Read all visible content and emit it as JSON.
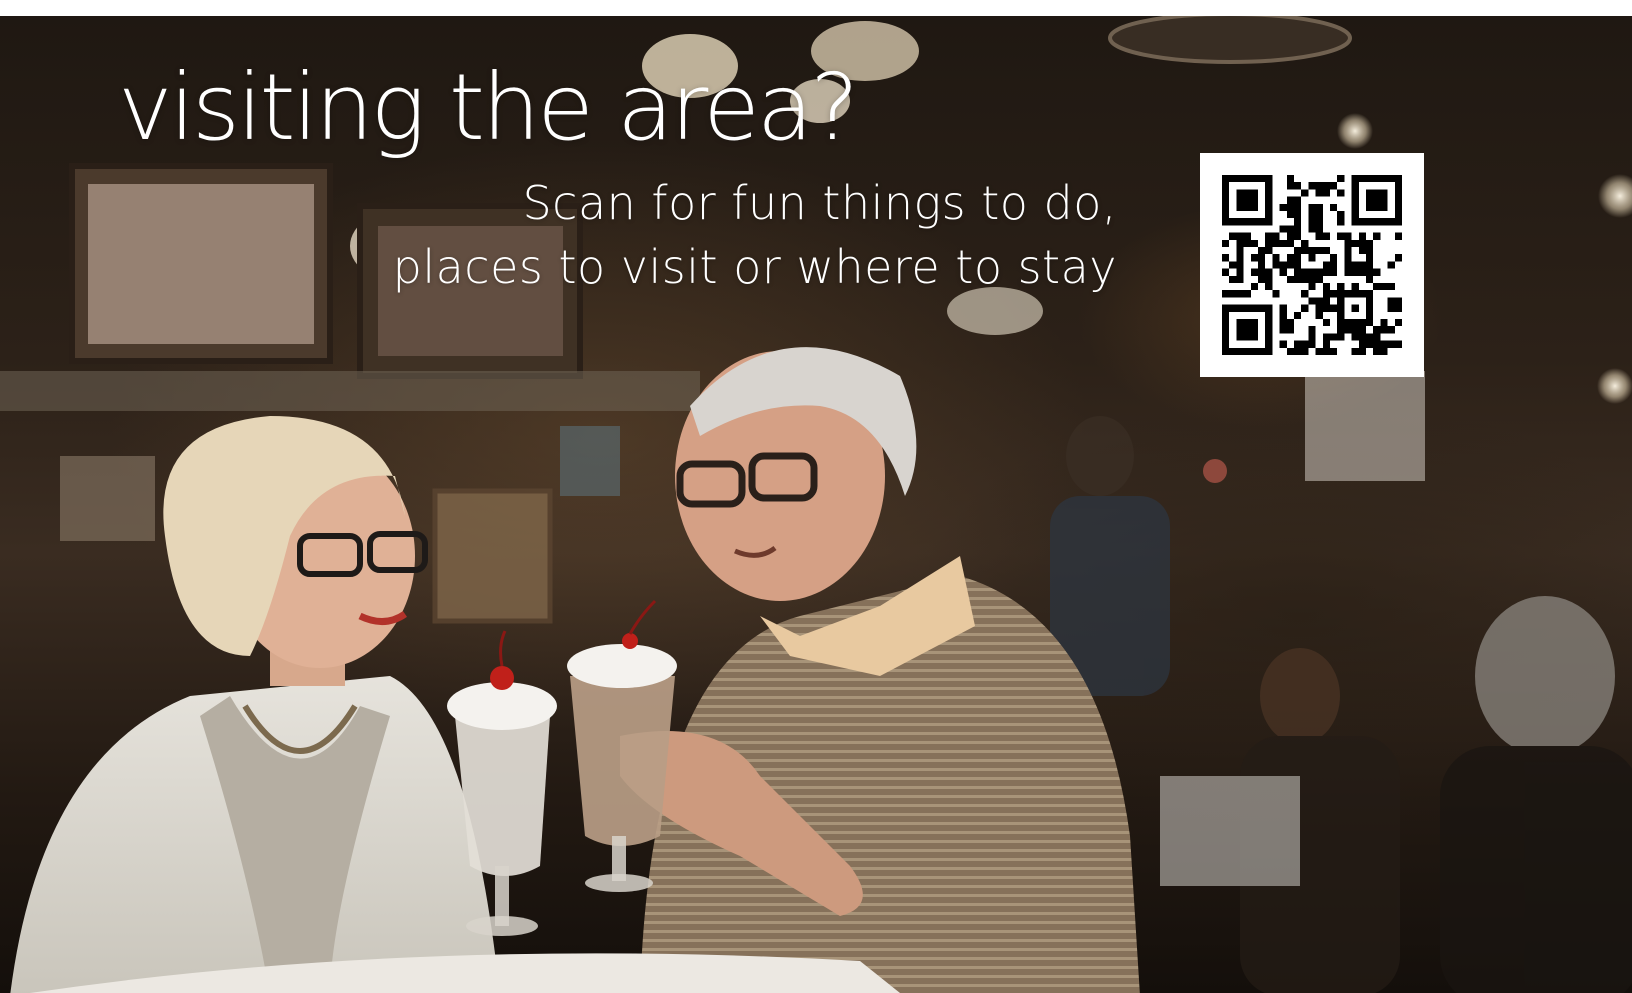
{
  "ad": {
    "headline": "visiting the area?",
    "subline_1": "Scan for fun things to do,",
    "subline_2": "places to visit or where to stay"
  },
  "icons": {
    "qr": "qr-code-icon"
  },
  "colors": {
    "text": "#ffffff",
    "qr_dark": "#000000",
    "qr_light": "#ffffff"
  }
}
